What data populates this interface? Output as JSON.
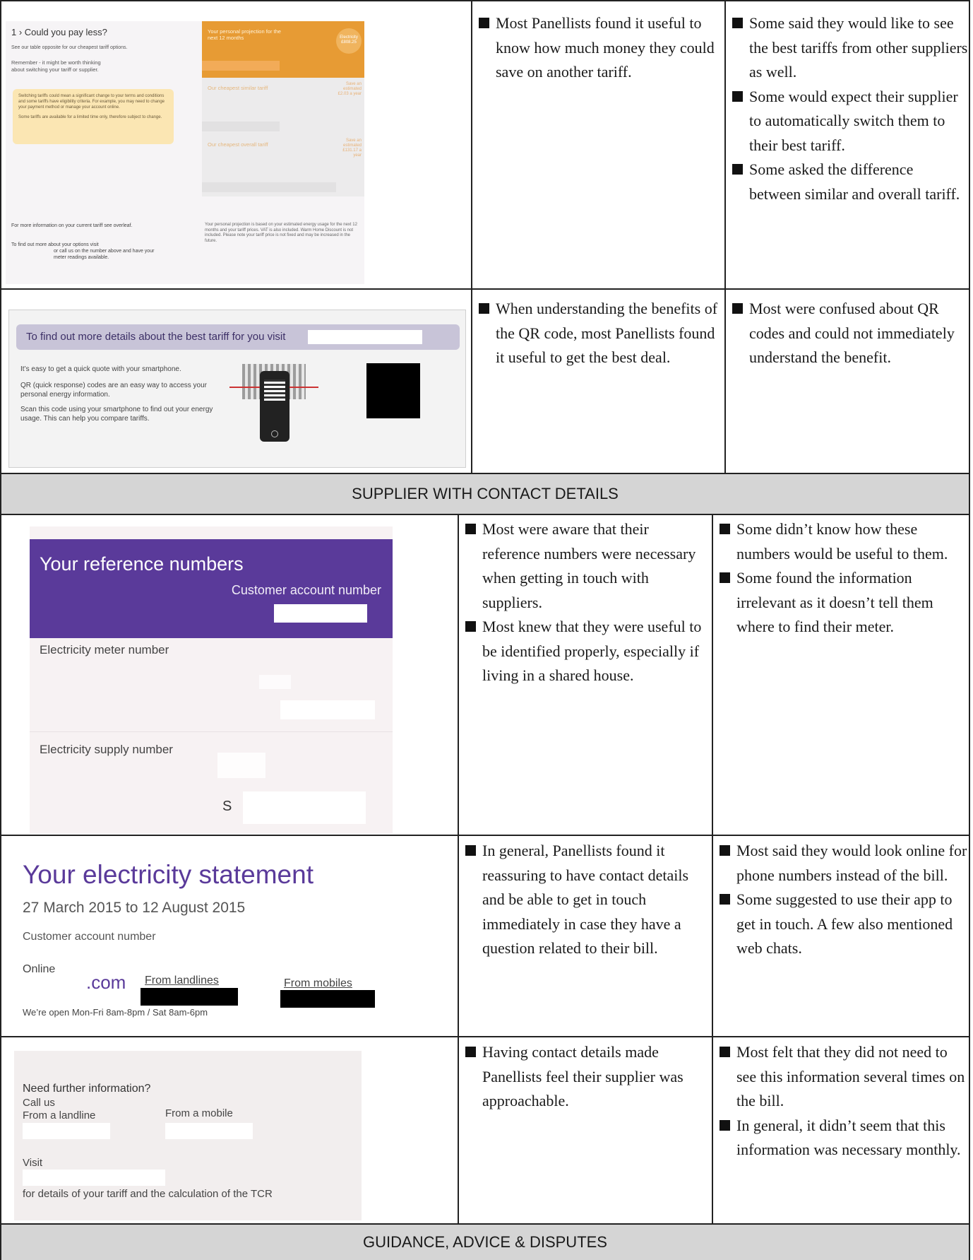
{
  "rows": [
    {
      "col2": [
        "Most Panellists found it useful to know how much money they could save on another tariff."
      ],
      "col3": [
        "Some said they would like to see the best tariffs from other suppliers as well.",
        "Some would expect their supplier to automatically switch them to their best tariff.",
        "Some asked the difference between similar and overall tariff."
      ]
    },
    {
      "col2": [
        "When understanding the benefits of the QR code, most Panellists found it useful to get the best deal."
      ],
      "col3": [
        "Most were confused about QR codes and could not immediately understand the benefit."
      ]
    },
    {
      "col2": [
        "Most were aware that their reference numbers were necessary when getting in touch with suppliers.",
        "Most knew that they were useful to be identified properly, especially if living in a shared house."
      ],
      "col3": [
        "Some didn’t know how these numbers would be useful to them.",
        "Some found the information irrelevant as it doesn’t tell them where to find their meter."
      ]
    },
    {
      "col2": [
        "In general, Panellists found it reassuring to have contact details and be able to get in touch immediately in case they have a question related to their bill."
      ],
      "col3": [
        "Most said they would look online for phone numbers instead of the bill.",
        "Some suggested to use their app to get in touch. A few also mentioned web chats."
      ]
    },
    {
      "col2": [
        "Having contact details made Panellists feel their supplier was approachable."
      ],
      "col3": [
        "Most felt that they did not need to see this information several times on the bill.",
        "In general, it didn’t seem that this information was necessary monthly."
      ]
    }
  ],
  "sections": {
    "supplier": "SUPPLIER WITH CONTACT DETAILS",
    "guidance": "GUIDANCE, ADVICE & DISPUTES"
  },
  "img1": {
    "heading": "1 › Could you pay less?",
    "line1": "See our table opposite for our cheapest tariff options.",
    "line2a": "Remember - it might be worth thinking",
    "line2b": "about switching your tariff or supplier.",
    "callout1": "Switching tariffs could mean a significant change to your terms and conditions and some tariffs have eligibility criteria. For example, you may need to change your payment method or manage your account online.",
    "callout2": "Some tariffs are available for a limited time only, therefore subject to change.",
    "more_info": "For more information on your current tariff see overleaf.",
    "find_out": "To find out more about your options visit",
    "find_out2": "or call us on the number above and have your meter readings available.",
    "projection_title": "Your personal projection for the next 12 months",
    "projection_badge_label": "Electricity",
    "projection_badge_value": "£808.25",
    "similar_title": "Our cheapest similar tariff",
    "similar_badge": "Save an estimated £2.03 a year",
    "overall_title": "Our cheapest overall tariff",
    "overall_badge": "Save an estimated £131.17 a year",
    "footnote": "Your personal projection is based on your estimated energy usage for the next 12 months and your tariff prices. VAT is also included. Warm Home Discount is not included. Please note your tariff price is not fixed and may be increased in the future."
  },
  "img2": {
    "banner": "To find out more details about the best tariff for you visit",
    "p1": "It’s easy to get a quick quote with your smartphone.",
    "p2": "QR (quick response) codes are an easy way to access your personal energy information.",
    "p3": "Scan this code using your smartphone to find out your energy usage. This can help you compare tariffs."
  },
  "img3": {
    "title": "Your reference numbers",
    "account": "Customer account number",
    "meter": "Electricity meter number",
    "supply": "Electricity supply number",
    "supply_prefix": "S"
  },
  "img4": {
    "title": "Your electricity statement",
    "dates": "27 March 2015 to 12 August 2015",
    "account": "Customer account number",
    "online": "Online",
    "domain": ".com",
    "landlines": "From landlines",
    "mobiles": "From mobiles",
    "hours": "We’re open Mon-Fri 8am-8pm / Sat 8am-6pm"
  },
  "img5": {
    "q": "Need further information?",
    "call": "Call us",
    "landline": "From a landline",
    "mobile": "From a mobile",
    "visit": "Visit",
    "details": "for details of your tariff and the calculation of the TCR"
  },
  "colors": {
    "purple": "#5a3a9a",
    "orange": "#e89b2f",
    "section_bg": "#d5d5d5"
  }
}
